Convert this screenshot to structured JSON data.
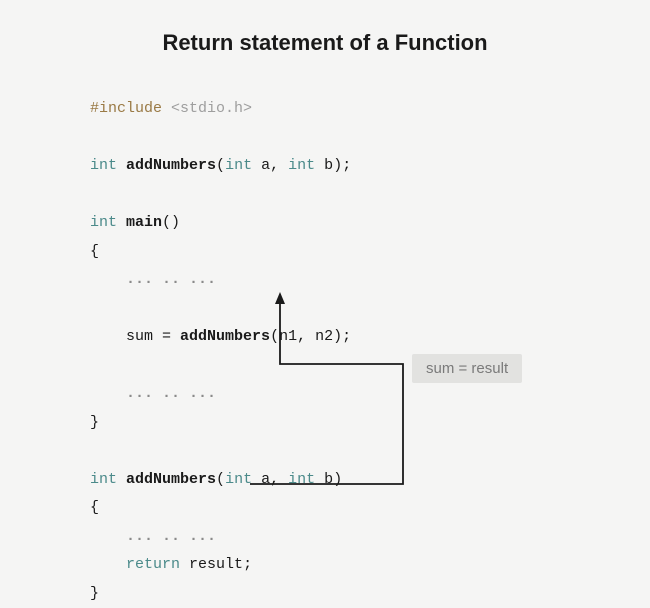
{
  "title": "Return statement of a Function",
  "code": {
    "include_directive": "#include",
    "include_header": "<stdio.h>",
    "type_int": "int",
    "fn_addNumbers": "addNumbers",
    "fn_main": "main",
    "param_a": "a",
    "param_b": "b",
    "var_sum": "sum",
    "arg_n1": "n1",
    "arg_n2": "n2",
    "dots": "... .. ...",
    "return_kw": "return",
    "return_val": "result",
    "brace_open": "{",
    "brace_close": "}",
    "semicolon": ";",
    "comma": ",",
    "eq": " = ",
    "paren_open": "(",
    "paren_close": ")",
    "empty_parens": "()"
  },
  "annotation": "sum = result"
}
